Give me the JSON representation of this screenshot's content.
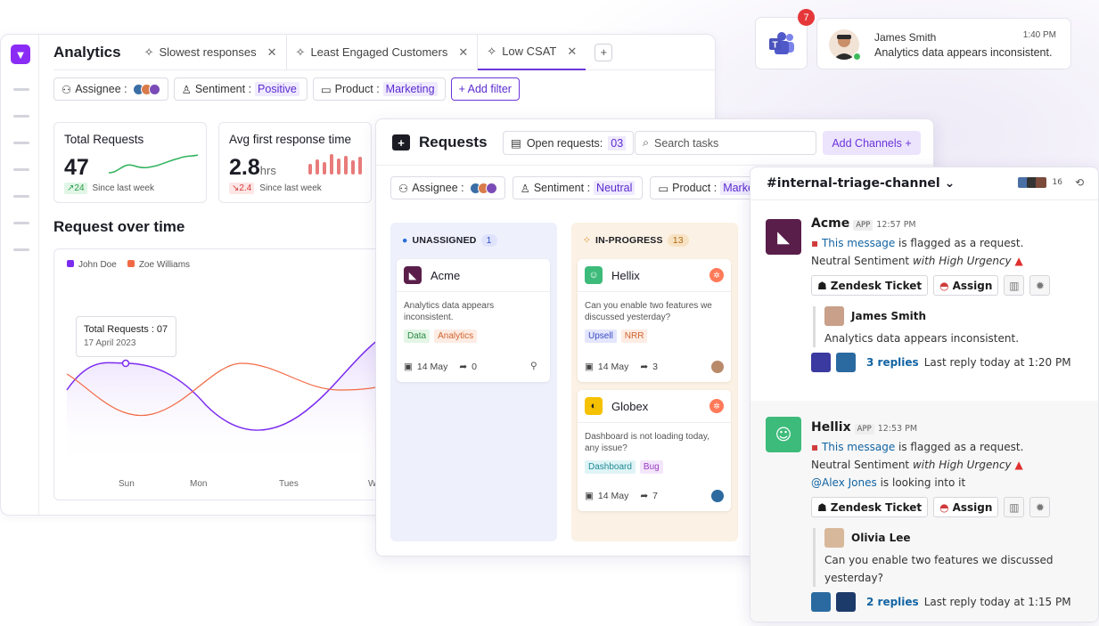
{
  "notification": {
    "badge_count": "7",
    "sender": "James Smith",
    "time": "1:40 PM",
    "message": "Analytics data appears inconsistent."
  },
  "analytics": {
    "title": "Analytics",
    "tabs": [
      {
        "label": "Slowest responses"
      },
      {
        "label": "Least Engaged Customers"
      },
      {
        "label": "Low CSAT"
      }
    ],
    "filters": {
      "assignee": "Assignee :",
      "sentiment_label": "Sentiment :",
      "sentiment_value": "Positive",
      "product_label": "Product :",
      "product_value": "Marketing",
      "add_filter": "+ Add filter"
    },
    "cards": [
      {
        "label": "Total Requests",
        "value": "47",
        "unit": "",
        "delta": "↗24",
        "delta_note": "Since last week"
      },
      {
        "label": "Avg first response time",
        "value": "2.8",
        "unit": "hrs",
        "delta": "↘2.4",
        "delta_note": "Since last week"
      }
    ],
    "chart_title": "Request over time",
    "tooltip_title": "Total Requests : 07",
    "tooltip_date": "17 April 2023"
  },
  "chart_data": {
    "type": "line",
    "title": "Request over time",
    "categories": [
      "Sun",
      "Mon",
      "Tues",
      "W"
    ],
    "series": [
      {
        "name": "John Doe",
        "color": "#7b2cf0"
      },
      {
        "name": "Zoe Williams",
        "color": "#f26a45"
      }
    ]
  },
  "requests": {
    "title": "Requests",
    "open_label": "Open requests:",
    "open_count": "03",
    "search_placeholder": "Search tasks",
    "add_channels": "Add Channels +",
    "filters": {
      "assignee": "Assignee :",
      "sentiment_label": "Sentiment :",
      "sentiment_value": "Neutral",
      "product_label": "Product :",
      "product_value": "Marketing"
    },
    "columns": [
      {
        "title": "UNASSIGNED",
        "count": "1"
      },
      {
        "title": "IN-PROGRESS",
        "count": "13"
      }
    ],
    "tasks": [
      {
        "company": "Acme",
        "desc": "Analytics data appears inconsistent.",
        "tags": [
          "Data",
          "Analytics"
        ],
        "date": "14 May",
        "shares": "0"
      },
      {
        "company": "Hellix",
        "desc": "Can you enable two features we discussed yesterday?",
        "tags": [
          "Upsell",
          "NRR"
        ],
        "date": "14 May",
        "shares": "3"
      },
      {
        "company": "Globex",
        "desc": "Dashboard is not loading today, any issue?",
        "tags": [
          "Dashboard",
          "Bug"
        ],
        "date": "14 May",
        "shares": "7"
      }
    ]
  },
  "slack": {
    "channel": "#internal-triage-channel",
    "member_count": "16",
    "messages": [
      {
        "sender": "Acme",
        "app": "APP",
        "time": "12:57 PM",
        "link": "This message",
        "flag_text": " is flagged as a request.",
        "sentiment": "Neutral Sentiment ",
        "urgency": "with High Urgency",
        "mention": "",
        "mention_text": "",
        "ticket_btn": "Zendesk Ticket",
        "assign_btn": "Assign",
        "quote_name": "James Smith",
        "quote_text": "Analytics data appears inconsistent.",
        "replies": "3 replies",
        "last_reply": "Last reply today at 1:20 PM"
      },
      {
        "sender": "Hellix",
        "app": "APP",
        "time": "12:53 PM",
        "link": "This message",
        "flag_text": " is flagged as a request.",
        "sentiment": "Neutral Sentiment ",
        "urgency": "with High Urgency",
        "mention": "@Alex Jones",
        "mention_text": " is looking into it",
        "ticket_btn": "Zendesk Ticket",
        "assign_btn": "Assign",
        "quote_name": "Olivia Lee",
        "quote_text": "Can you enable two features we discussed yesterday?",
        "replies": "2 replies",
        "last_reply": "Last reply today at 1:15 PM"
      }
    ]
  }
}
